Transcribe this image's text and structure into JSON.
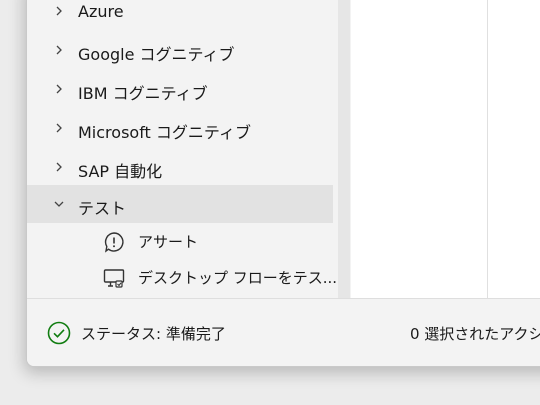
{
  "tree": {
    "groups": [
      {
        "label": "Azure",
        "expanded": false
      },
      {
        "label": "Google コグニティブ",
        "expanded": false
      },
      {
        "label": "IBM コグニティブ",
        "expanded": false
      },
      {
        "label": "Microsoft コグニティブ",
        "expanded": false
      },
      {
        "label": "SAP 自動化",
        "expanded": false
      },
      {
        "label": "テスト",
        "expanded": true
      }
    ],
    "children": [
      {
        "label": "アサート",
        "icon": "exclamation-circle-icon"
      },
      {
        "label": "デスクトップ フローをテス...",
        "icon": "monitor-flow-icon"
      }
    ]
  },
  "status": {
    "text": "ステータス: 準備完了",
    "icon": "check-circle-icon",
    "icon_color": "#107c10",
    "selected_actions": "0 選択されたアクシ"
  }
}
